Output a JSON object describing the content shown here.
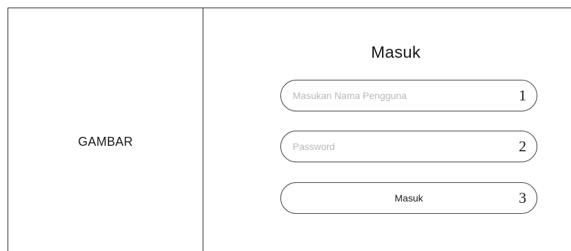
{
  "image_panel": {
    "label": "GAMBAR"
  },
  "login": {
    "title": "Masuk",
    "username": {
      "placeholder": "Masukan Nama Pengguna",
      "value": "",
      "marker": "1"
    },
    "password": {
      "placeholder": "Password",
      "value": "",
      "marker": "2"
    },
    "submit": {
      "label": "Masuk",
      "marker": "3"
    }
  }
}
